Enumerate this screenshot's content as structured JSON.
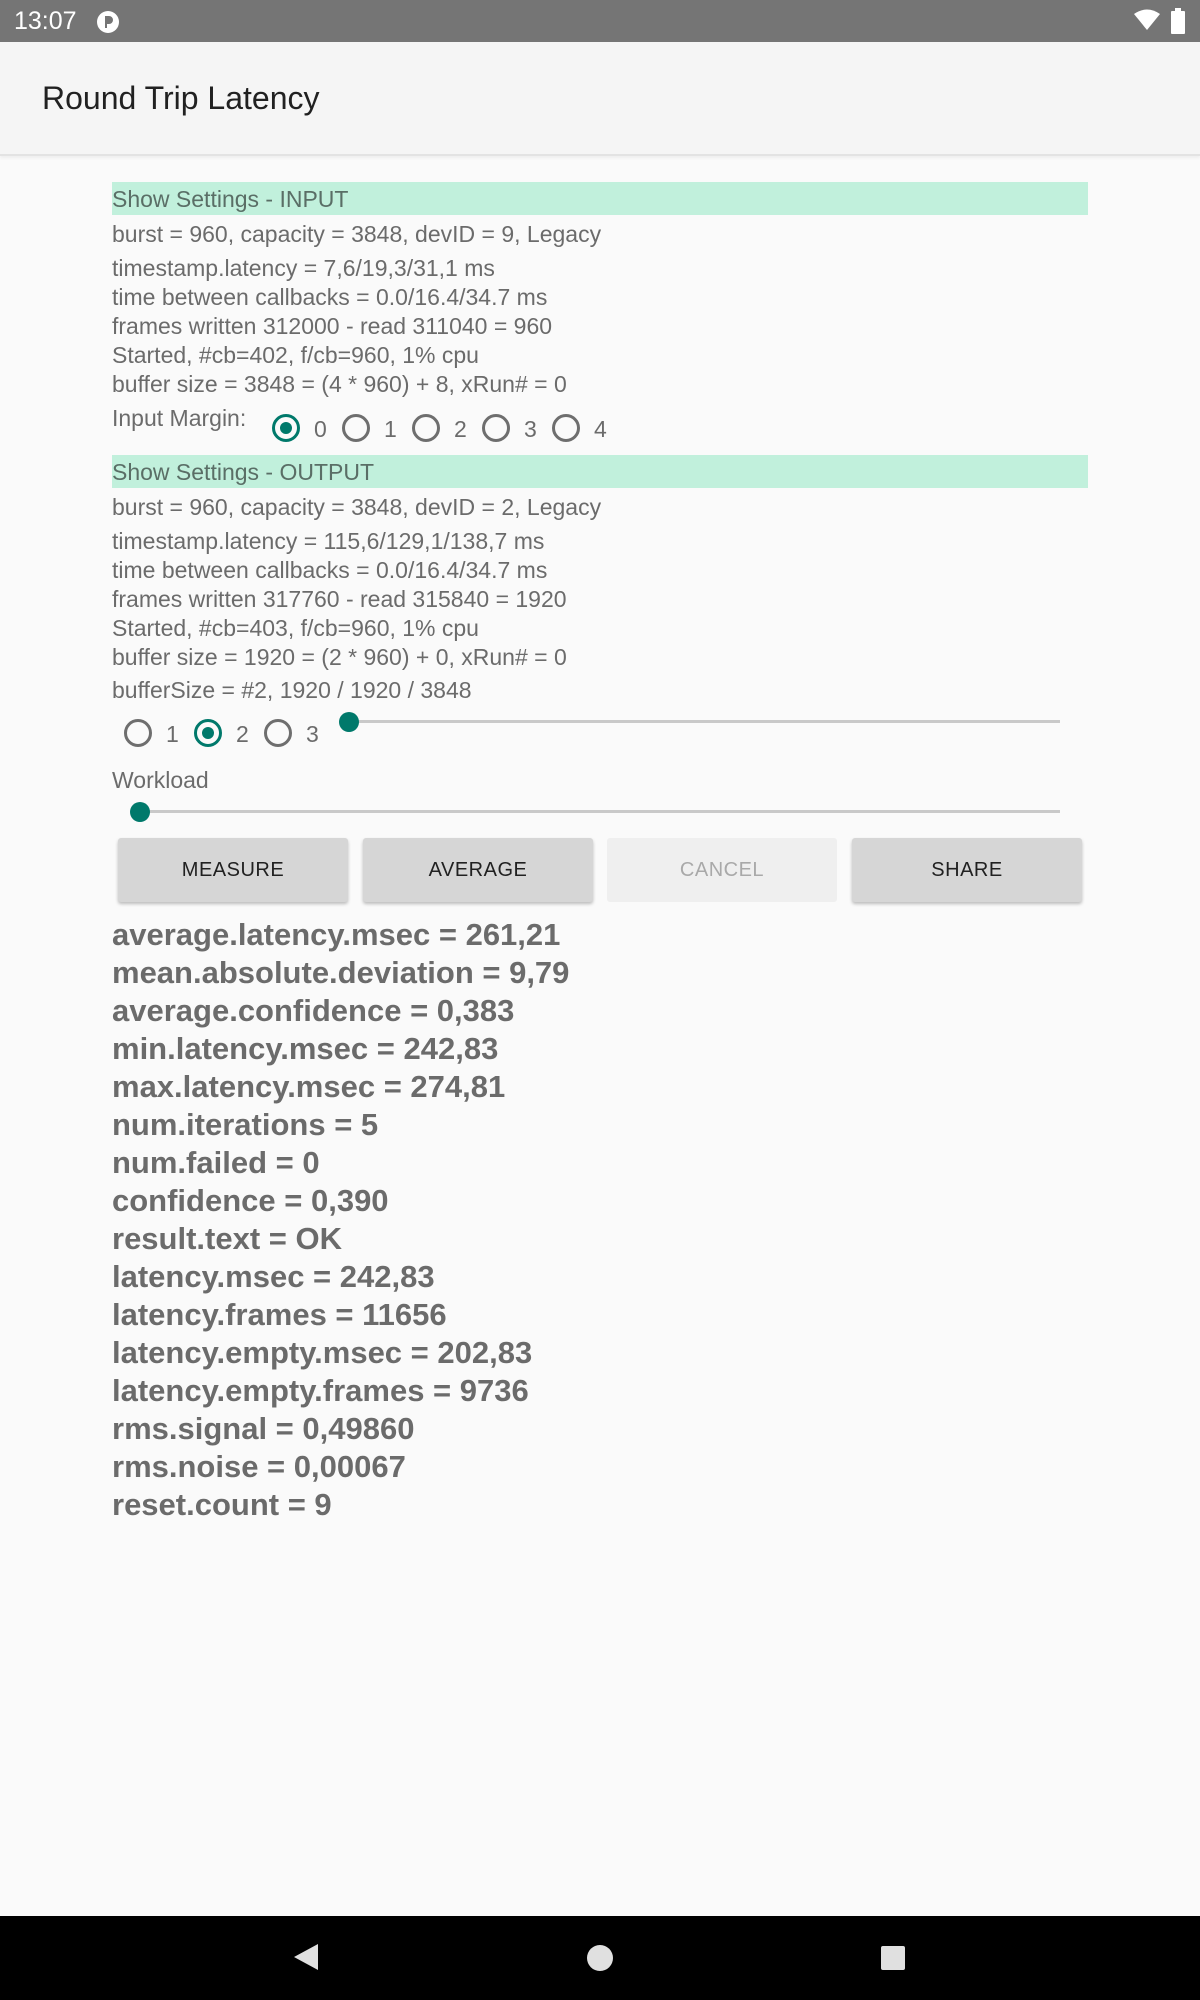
{
  "status_bar": {
    "time": "13:07"
  },
  "app_bar": {
    "title": "Round Trip Latency"
  },
  "input": {
    "header": "Show Settings - INPUT",
    "lines": [
      "burst = 960, capacity = 3848, devID = 9, Legacy",
      "timestamp.latency = 7,6/19,3/31,1 ms",
      "time between callbacks = 0.0/16.4/34.7 ms",
      "frames written 312000 - read 311040 = 960",
      "Started, #cb=402, f/cb=960,  1% cpu",
      "buffer size = 3848 = (4 * 960) + 8,   xRun# = 0"
    ],
    "margin_label": "Input Margin:",
    "margin_options": [
      "0",
      "1",
      "2",
      "3",
      "4"
    ],
    "margin_selected": "0"
  },
  "output": {
    "header": "Show Settings - OUTPUT",
    "lines": [
      "burst = 960, capacity = 3848, devID = 2, Legacy",
      "timestamp.latency = 115,6/129,1/138,7 ms",
      "time between callbacks = 0.0/16.4/34.7 ms",
      "frames written 317760 - read 315840 = 1920",
      "Started, #cb=403, f/cb=960,  1% cpu",
      "buffer size = 1920 = (2 * 960) + 0,   xRun# = 0",
      "bufferSize = #2, 1920 / 1920 / 3848"
    ],
    "buffer_options": [
      "1",
      "2",
      "3"
    ],
    "buffer_selected": "2",
    "buffer_slider_fraction": 0
  },
  "workload": {
    "label": "Workload",
    "slider_fraction": 0
  },
  "buttons": {
    "measure": "MEASURE",
    "average": "AVERAGE",
    "cancel": "CANCEL",
    "share": "SHARE"
  },
  "results": [
    "average.latency.msec = 261,21",
    "mean.absolute.deviation = 9,79",
    "average.confidence = 0,383",
    "min.latency.msec = 242,83",
    "max.latency.msec = 274,81",
    "num.iterations = 5",
    "num.failed = 0",
    "confidence = 0,390",
    "result.text = OK",
    "latency.msec = 242,83",
    "latency.frames = 11656",
    "latency.empty.msec = 202,83",
    "latency.empty.frames = 9736",
    "rms.signal = 0,49860",
    "rms.noise = 0,00067",
    "reset.count = 9"
  ],
  "colors": {
    "accent": "#00796b",
    "header_bg": "#c1f0dc",
    "status_bar": "#757575",
    "nav_bar": "#000000"
  }
}
